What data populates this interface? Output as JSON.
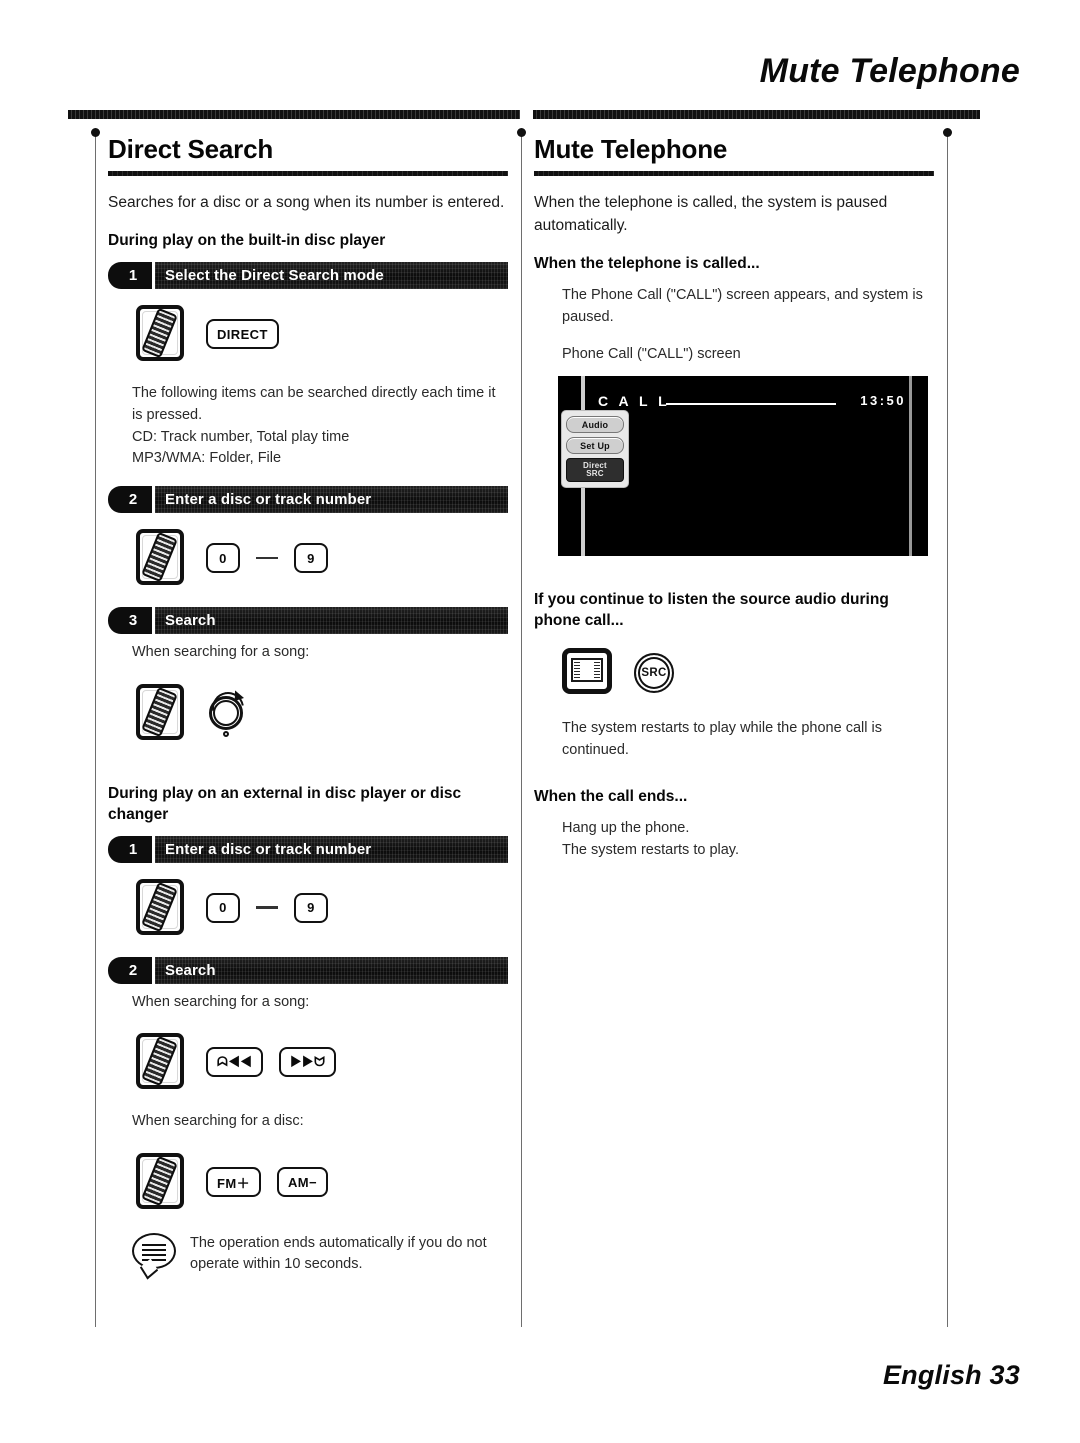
{
  "running_head": "Mute Telephone",
  "footer": "English 33",
  "left_column": {
    "title": "Direct Search",
    "intro": "Searches for a disc or a song when its number is entered.",
    "section1_heading": "During play on the built-in disc player",
    "s1_step1": {
      "num": "1",
      "label": "Select the Direct Search mode"
    },
    "s1_step1_keys": {
      "direct": "DIRECT"
    },
    "s1_note_line1": "The following items can be searched directly each time it is pressed.",
    "s1_note_line2": "CD: Track number, Total play time",
    "s1_note_line3": "MP3/WMA: Folder, File",
    "s1_step2": {
      "num": "2",
      "label": "Enter a disc or track number"
    },
    "s1_step2_keys": {
      "from": "0",
      "to": "9"
    },
    "s1_step3": {
      "num": "3",
      "label": "Search"
    },
    "s1_step3_caption": "When searching for a song:",
    "section2_heading": "During play on an external in disc player or disc changer",
    "s2_step1": {
      "num": "1",
      "label": "Enter a disc or track number"
    },
    "s2_step1_keys": {
      "from": "0",
      "to": "9"
    },
    "s2_step2": {
      "num": "2",
      "label": "Search"
    },
    "s2_song_caption": "When searching for a song:",
    "s2_song_keys": {
      "prev": "ᗣ◀◀",
      "next": "▶▶ᗢ"
    },
    "s2_disc_caption": "When searching for a disc:",
    "s2_disc_keys": {
      "fm": "FM＋",
      "am": "AM−"
    },
    "tip": "The operation ends automatically if you do not operate within 10 seconds."
  },
  "right_column": {
    "title": "Mute Telephone",
    "intro": "When the telephone is called, the system is paused automatically.",
    "h1": "When the telephone is called...",
    "h1_body": "The Phone Call (\"CALL\") screen appears, and system is paused.",
    "screen_caption": "Phone Call (\"CALL\") screen",
    "call_screen": {
      "title": "C A L L",
      "time": "13:50",
      "buttons": [
        "Audio",
        "Set Up"
      ],
      "dark_button_line1": "Direct",
      "dark_button_line2": "SRC"
    },
    "h2": "If you continue to listen the source audio during phone call...",
    "h2_key": "SRC",
    "h2_body": "The system restarts to play while the phone call is continued.",
    "h3": "When the call ends...",
    "h3_body_line1": "Hang up the phone.",
    "h3_body_line2": "The system restarts to play."
  }
}
